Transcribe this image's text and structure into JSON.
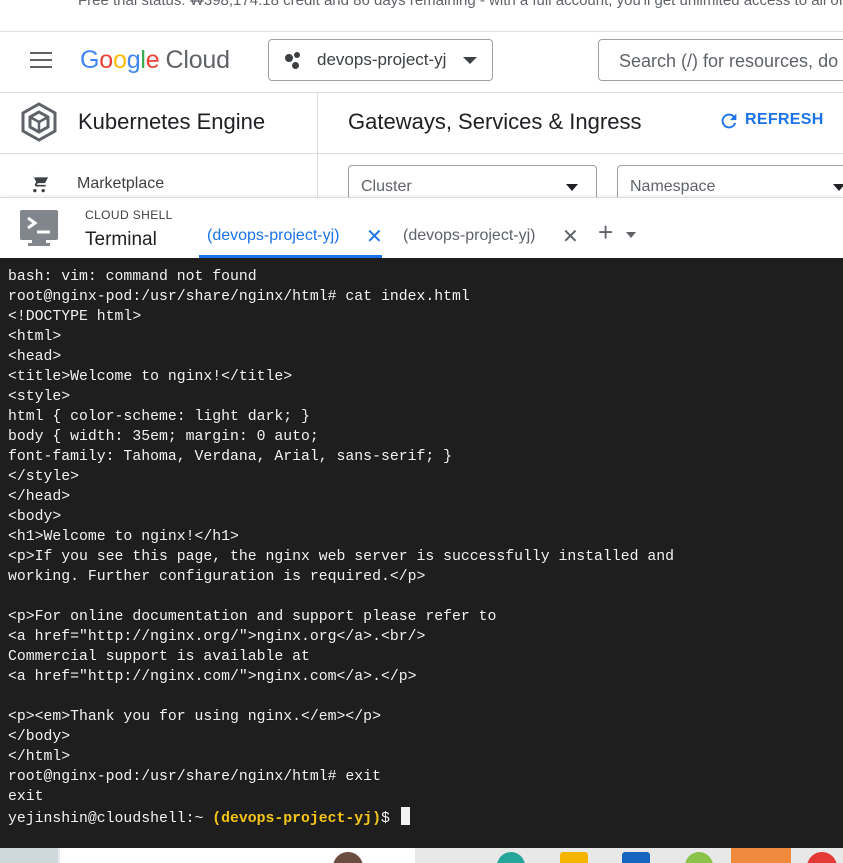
{
  "trial_banner": {
    "text": "Free trial status: ₩398,174.18 credit and 86 days remaining - with a full account, you'll get unlimited access to all of"
  },
  "header": {
    "logo_letters": [
      "G",
      "o",
      "o",
      "g",
      "l",
      "e"
    ],
    "logo_cloud": "Cloud",
    "project_selector": "devops-project-yj",
    "search_placeholder": "Search (/) for resources, do"
  },
  "product": {
    "title": "Kubernetes Engine",
    "nav_item": "Marketplace"
  },
  "page": {
    "title": "Gateways, Services & Ingress",
    "refresh_label": "REFRESH",
    "filters": {
      "cluster": "Cluster",
      "namespace": "Namespace"
    }
  },
  "cloud_shell": {
    "label_small": "CLOUD SHELL",
    "label_big": "Terminal",
    "tabs": [
      {
        "label": "(devops-project-yj)",
        "active": true
      },
      {
        "label": "(devops-project-yj)",
        "active": false
      }
    ],
    "close_glyph": "✕",
    "add_glyph": "+"
  },
  "terminal": {
    "lines": [
      "bash: vim: command not found",
      "root@nginx-pod:/usr/share/nginx/html# cat index.html",
      "<!DOCTYPE html>",
      "<html>",
      "<head>",
      "<title>Welcome to nginx!</title>",
      "<style>",
      "html { color-scheme: light dark; }",
      "body { width: 35em; margin: 0 auto;",
      "font-family: Tahoma, Verdana, Arial, sans-serif; }",
      "</style>",
      "</head>",
      "<body>",
      "<h1>Welcome to nginx!</h1>",
      "<p>If you see this page, the nginx web server is successfully installed and",
      "working. Further configuration is required.</p>",
      "",
      "<p>For online documentation and support please refer to",
      "<a href=\"http://nginx.org/\">nginx.org</a>.<br/>",
      "Commercial support is available at",
      "<a href=\"http://nginx.com/\">nginx.com</a>.</p>",
      "",
      "<p><em>Thank you for using nginx.</em></p>",
      "</body>",
      "</html>",
      "root@nginx-pod:/usr/share/nginx/html# exit",
      "exit"
    ],
    "prompt_user": "yejinshin@cloudshell:~ ",
    "prompt_project": "(devops-project-yj)",
    "prompt_suffix": "$ "
  },
  "colors": {
    "accent": "#1a73e8",
    "terminal_bg": "#1e1e1e",
    "terminal_fg": "#f2f2f2",
    "prompt_project": "#f5c518"
  }
}
